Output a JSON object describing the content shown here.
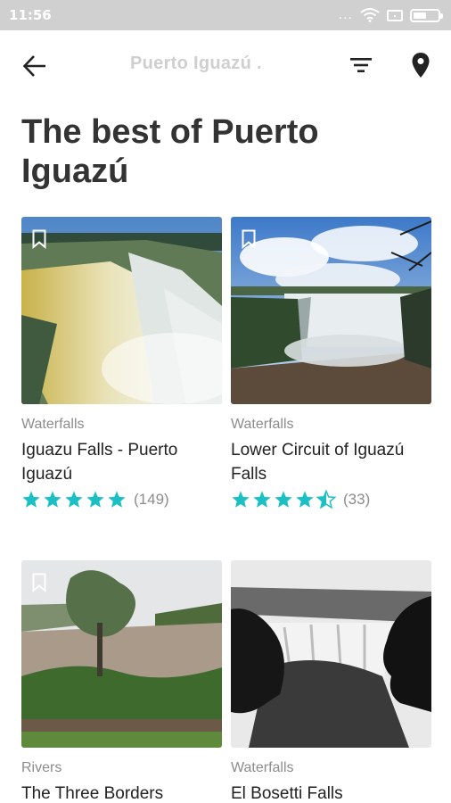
{
  "status_bar": {
    "time": "11:56",
    "dots": "...",
    "icons": [
      "wifi-icon",
      "sim-icon",
      "battery-icon"
    ]
  },
  "toolbar": {
    "title": "Puerto Iguazú .",
    "back_icon": "arrow-left-icon",
    "filter_icon": "filter-icon",
    "map_icon": "map-pin-icon"
  },
  "page": {
    "title": "The best of Puerto Iguazú"
  },
  "accent_color": "#1bbfc4",
  "cards": [
    {
      "category": "Waterfalls",
      "title": "Iguazu Falls - Puerto Iguazú",
      "rating": 5,
      "rating_count": "(149)"
    },
    {
      "category": "Waterfalls",
      "title": "Lower Circuit of Iguazú Falls",
      "rating": 4.5,
      "rating_count": "(33)"
    },
    {
      "category": "Rivers",
      "title": "The Three Borders"
    },
    {
      "category": "Waterfalls",
      "title": "El Bosetti Falls"
    }
  ]
}
